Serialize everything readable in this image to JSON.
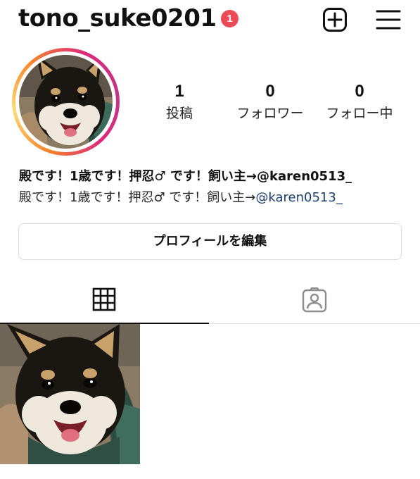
{
  "header": {
    "username": "tono_suke0201",
    "notification_count": "1",
    "add_icon": "plus-square-icon",
    "menu_icon": "hamburger-menu-icon"
  },
  "profile": {
    "stats": {
      "posts": {
        "value": "1",
        "label": "投稿"
      },
      "followers": {
        "value": "0",
        "label": "フォロワー"
      },
      "following": {
        "value": "0",
        "label": "フォロー中"
      }
    },
    "bio": {
      "name": "殿です！1歳です！押忍♂  です！飼い主→@karen0513_",
      "text": "殿です！1歳です！押忍♂  です！飼い主→",
      "link": "@karen0513_"
    },
    "edit_button_label": "プロフィールを編集"
  },
  "tabs": [
    {
      "icon": "grid-icon",
      "active": true
    },
    {
      "icon": "tagged-person-icon",
      "active": false
    }
  ],
  "posts": [
    {
      "type": "photo",
      "subject": "shiba-inu-dog"
    }
  ],
  "colors": {
    "badge": "#ed4956",
    "link": "#1c3f6e",
    "border": "#dbdbdb",
    "ring_start": "#f58529",
    "ring_end": "#c13584"
  }
}
